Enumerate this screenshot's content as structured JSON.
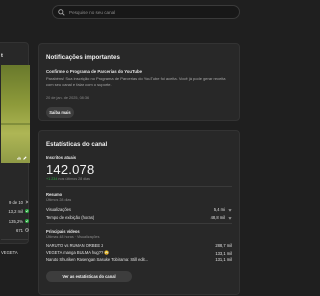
{
  "search": {
    "placeholder": "Pesquise no seu canal"
  },
  "left_card": {
    "title_fragment": "t",
    "stats": [
      {
        "label": "",
        "value": "9 de 10",
        "icon": "chevron-icon"
      },
      {
        "label": "",
        "value": "13,2 mil",
        "icon": "check-circle-icon"
      },
      {
        "label": "",
        "value": "135,2%",
        "icon": "check-circle-icon"
      },
      {
        "label": "",
        "value": "671",
        "icon": "clock-icon"
      }
    ],
    "footer_fragment": "VEGETA"
  },
  "notifications": {
    "title": "Notificações importantes",
    "item_title": "Confirme o Programa de Parcerias do YouTube",
    "item_body": "Parabéns! Sua inscrição no Programa de Parcerias do YouTube foi aceita. Você já pode gerar receita com seu canal e falar com o suporte.",
    "date": "20 de jan. de 2025, 08:36",
    "button": "Saiba mais"
  },
  "stats": {
    "title": "Estatísticas do canal",
    "subs_label": "Inscritos atuais",
    "subs_value": "142.078",
    "subs_growth_value": "+1.234",
    "subs_growth_text": "nos últimos 28 dias",
    "summary_label": "Resumo",
    "summary_hint": "Últimos 28 dias",
    "summary_rows": [
      {
        "label": "Visualizações",
        "value": "5,4 mi"
      },
      {
        "label": "Tempo de exibição (horas)",
        "value": "48,8 mil"
      }
    ],
    "top_videos_label": "Principais vídeos",
    "top_videos_hint": "Últimas 48 horas · Visualizações",
    "top_videos": [
      {
        "title": "NARUTO vs RUMAN ORBEE 2",
        "value": "288,7 mil"
      },
      {
        "title": "VEGETA manga BULMA hug?? 😳",
        "value": "133,1 mil"
      },
      {
        "title": "Naruto Shuriken Rasengan Sasuke Tobirama: Still edit...",
        "value": "131,1 mil"
      }
    ],
    "button": "Ver as estatísticas do canal"
  },
  "colors": {
    "background": "#1f1f1f",
    "card": "#282828",
    "accent_green": "#2ba640",
    "muted": "#8c8c8c"
  }
}
